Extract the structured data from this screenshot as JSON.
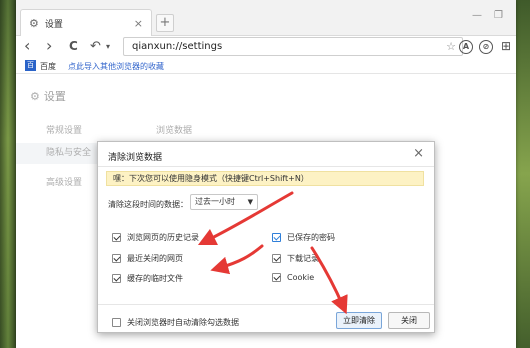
{
  "tab": {
    "title": "设置",
    "close": "×",
    "new_tab": "+"
  },
  "window_controls": {
    "minimize": "—",
    "restore": "❐"
  },
  "nav": {
    "back": "‹",
    "forward": "›",
    "reload": "C",
    "undo": "↶",
    "undo_caret": "▾",
    "url": "qianxun://settings",
    "star": "☆",
    "icons": [
      "A",
      "⊘"
    ],
    "download": "⊞"
  },
  "bookmarks": {
    "icon_text": "百",
    "item1": "百度",
    "item2": "点此导入其他浏览器的收藏"
  },
  "settings": {
    "title": "设置",
    "gear": "⚙",
    "nav": [
      "常规设置",
      "隐私与安全",
      "高级设置"
    ],
    "subhead": "浏览数据"
  },
  "dialog": {
    "title": "清除浏览数据",
    "close": "×",
    "tip": "嘿：下次您可以使用隐身模式（快捷键Ctrl+Shift+N）",
    "range_label": "清除这段时间的数据：",
    "range_value": "过去一小时",
    "range_caret": "▼",
    "left_options": [
      {
        "label": "浏览网页的历史记录",
        "checked": true
      },
      {
        "label": "最近关闭的网页",
        "checked": true
      },
      {
        "label": "缓存的临时文件",
        "checked": true
      }
    ],
    "right_options": [
      {
        "label": "已保存的密码",
        "checked": true
      },
      {
        "label": "下载记录",
        "checked": true
      },
      {
        "label": "Cookie",
        "checked": true
      }
    ],
    "auto_clear_label": "关闭浏览器时自动清除勾选数据",
    "auto_clear_checked": false,
    "clear_button": "立即清除",
    "close_button": "关闭"
  },
  "colors": {
    "annotation_red": "#e53935",
    "link_blue": "#3366cc",
    "tip_bg": "#fdf2c4"
  }
}
